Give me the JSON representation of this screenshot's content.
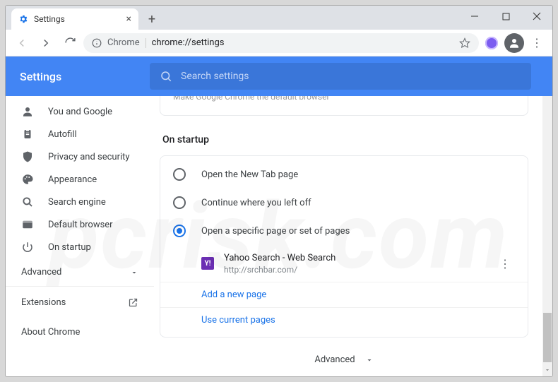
{
  "window": {
    "tab_title": "Settings",
    "omnibox_prefix": "Chrome",
    "omnibox_url": "chrome://settings"
  },
  "appbar": {
    "title": "Settings",
    "search_placeholder": "Search settings"
  },
  "sidebar": {
    "items": [
      {
        "label": "You and Google"
      },
      {
        "label": "Autofill"
      },
      {
        "label": "Privacy and security"
      },
      {
        "label": "Appearance"
      },
      {
        "label": "Search engine"
      },
      {
        "label": "Default browser"
      },
      {
        "label": "On startup"
      }
    ],
    "advanced": "Advanced",
    "extensions": "Extensions",
    "about": "About Chrome"
  },
  "content": {
    "truncated_top": "Make Google Chrome the default browser",
    "section_title": "On startup",
    "options": {
      "new_tab": "Open the New Tab page",
      "continue": "Continue where you left off",
      "specific": "Open a specific page or set of pages"
    },
    "page": {
      "title": "Yahoo Search - Web Search",
      "url": "http://srchbar.com/"
    },
    "add_new": "Add a new page",
    "use_current": "Use current pages",
    "advanced_footer": "Advanced"
  },
  "watermark": "pcrisk.com"
}
